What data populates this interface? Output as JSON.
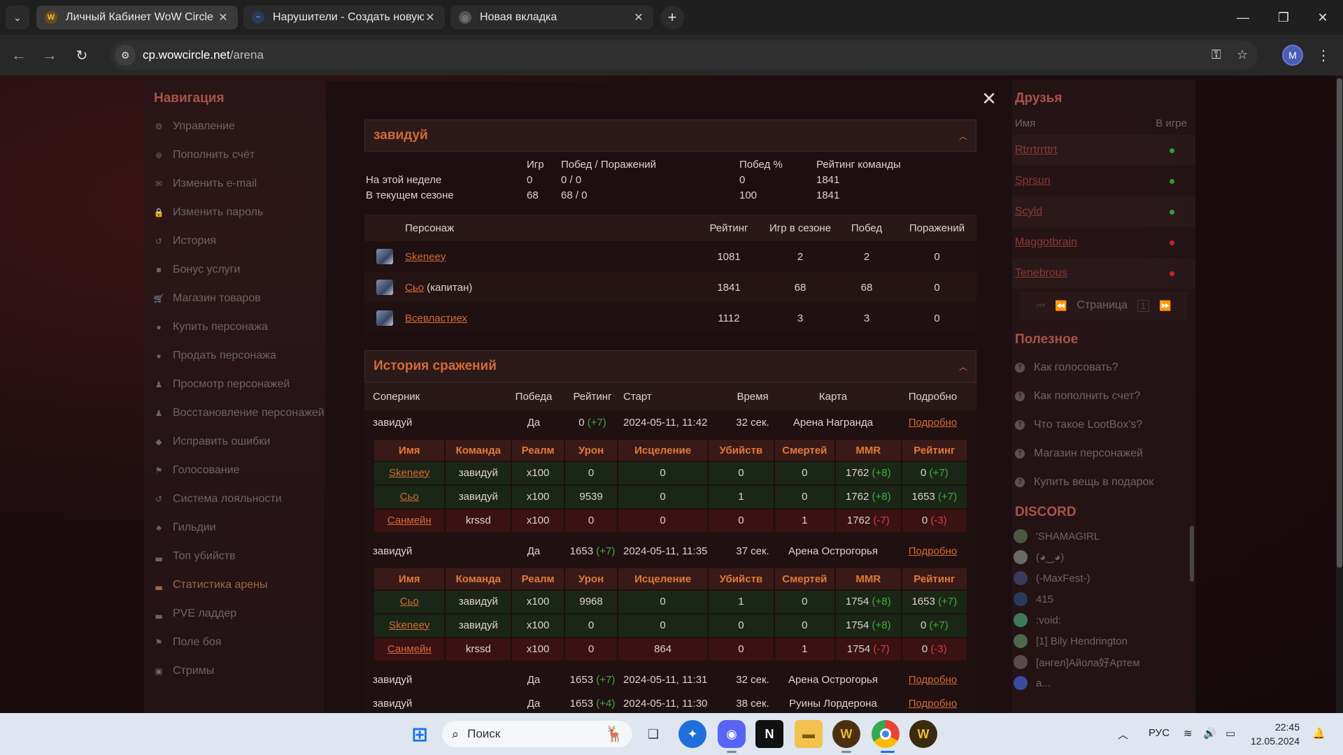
{
  "browser": {
    "tabs": [
      {
        "title": "Личный Кабинет WoW Circle I",
        "active": true
      },
      {
        "title": "Нарушители - Создать новую",
        "active": false
      },
      {
        "title": "Новая вкладка",
        "active": false
      }
    ],
    "url_host": "cp.wowcircle.net",
    "url_path": "/arena",
    "profile_initial": "M"
  },
  "leftnav": {
    "title": "Навигация",
    "items": [
      {
        "label": "Управление",
        "icon": "gear-icon",
        "glyph": "⚙"
      },
      {
        "label": "Пополнить счёт",
        "icon": "plus-circle-icon",
        "glyph": "⊕"
      },
      {
        "label": "Изменить e-mail",
        "icon": "envelope-icon",
        "glyph": "✉"
      },
      {
        "label": "Изменить пароль",
        "icon": "lock-icon",
        "glyph": "🔒"
      },
      {
        "label": "История",
        "icon": "history-icon",
        "glyph": "↺"
      },
      {
        "label": "Бонус услуги",
        "icon": "bonus-icon",
        "glyph": "■"
      },
      {
        "label": "Магазин товаров",
        "icon": "cart-icon",
        "glyph": "🛒"
      },
      {
        "label": "Купить персонажа",
        "icon": "user-icon",
        "glyph": "●"
      },
      {
        "label": "Продать персонажа",
        "icon": "user-icon",
        "glyph": "●"
      },
      {
        "label": "Просмотр персонажей",
        "icon": "male-icon",
        "glyph": "♟"
      },
      {
        "label": "Восстановление персонажей",
        "icon": "male-icon",
        "glyph": "♟"
      },
      {
        "label": "Исправить ошибки",
        "icon": "shield-icon",
        "glyph": "◆"
      },
      {
        "label": "Голосование",
        "icon": "flag-icon",
        "glyph": "⚑"
      },
      {
        "label": "Система лояльности",
        "icon": "history-icon",
        "glyph": "↺"
      },
      {
        "label": "Гильдии",
        "icon": "users-icon",
        "glyph": "♣"
      },
      {
        "label": "Топ убийств",
        "icon": "chart-icon",
        "glyph": "▃"
      },
      {
        "label": "Статистика арены",
        "icon": "chart-icon",
        "glyph": "▃",
        "active": true
      },
      {
        "label": "PVE ладдер",
        "icon": "chart-icon",
        "glyph": "▃"
      },
      {
        "label": "Поле боя",
        "icon": "flag-icon",
        "glyph": "⚑"
      },
      {
        "label": "Стримы",
        "icon": "stream-icon",
        "glyph": "▣"
      }
    ]
  },
  "team": {
    "name": "завидуй",
    "stats_headers": {
      "games": "Игр",
      "wl": "Побед / Поражений",
      "winpct": "Побед %",
      "rating": "Рейтинг команды"
    },
    "stats_rows": [
      {
        "label": "На этой неделе",
        "games": "0",
        "wl": "0 / 0",
        "winpct": "0",
        "rating": "1841"
      },
      {
        "label": "В текущем сезоне",
        "games": "68",
        "wl": "68 / 0",
        "winpct": "100",
        "rating": "1841"
      }
    ],
    "roster_headers": [
      "Персонаж",
      "Рейтинг",
      "Игр в сезоне",
      "Побед",
      "Поражений"
    ],
    "roster": [
      {
        "name": "Skeneey",
        "suffix": "",
        "rating": "1081",
        "games": "2",
        "wins": "2",
        "losses": "0"
      },
      {
        "name": "Сьо",
        "suffix": " (капитан)",
        "rating": "1841",
        "games": "68",
        "wins": "68",
        "losses": "0"
      },
      {
        "name": "Всевластиех",
        "suffix": "",
        "rating": "1112",
        "games": "3",
        "wins": "3",
        "losses": "0"
      }
    ]
  },
  "history": {
    "title": "История сражений",
    "headers": [
      "Соперник",
      "Победа",
      "Рейтинг",
      "Старт",
      "Время",
      "Карта",
      "Подробно"
    ],
    "detail_headers": [
      "Имя",
      "Команда",
      "Реалм",
      "Урон",
      "Исцеление",
      "Убийств",
      "Смертей",
      "MMR",
      "Рейтинг"
    ],
    "matches": [
      {
        "opponent": "завидуй",
        "win": "Да",
        "rating": "0",
        "rating_delta": "(+7)",
        "start": "2024-05-11, 11:42",
        "time": "32 сек.",
        "map": "Арена Награнда",
        "details": "Подробно",
        "players": [
          {
            "name": "Skeneey",
            "team": "завидуй",
            "realm": "x100",
            "damage": "0",
            "heal": "0",
            "kills": "0",
            "deaths": "0",
            "mmr": "1762",
            "mmr_delta": "(+8)",
            "rating": "0",
            "rating_delta": "(+7)",
            "side": "ally"
          },
          {
            "name": "Сьо",
            "team": "завидуй",
            "realm": "x100",
            "damage": "9539",
            "heal": "0",
            "kills": "1",
            "deaths": "0",
            "mmr": "1762",
            "mmr_delta": "(+8)",
            "rating": "1653",
            "rating_delta": "(+7)",
            "side": "ally"
          },
          {
            "name": "Санмейн",
            "team": "krssd",
            "realm": "x100",
            "damage": "0",
            "heal": "0",
            "kills": "0",
            "deaths": "1",
            "mmr": "1762",
            "mmr_delta": "(-7)",
            "rating": "0",
            "rating_delta": "(-3)",
            "side": "enemy"
          }
        ]
      },
      {
        "opponent": "завидуй",
        "win": "Да",
        "rating": "1653",
        "rating_delta": "(+7)",
        "start": "2024-05-11, 11:35",
        "time": "37 сек.",
        "map": "Арена Острогорья",
        "details": "Подробно",
        "players": [
          {
            "name": "Сьо",
            "team": "завидуй",
            "realm": "x100",
            "damage": "9968",
            "heal": "0",
            "kills": "1",
            "deaths": "0",
            "mmr": "1754",
            "mmr_delta": "(+8)",
            "rating": "1653",
            "rating_delta": "(+7)",
            "side": "ally"
          },
          {
            "name": "Skeneey",
            "team": "завидуй",
            "realm": "x100",
            "damage": "0",
            "heal": "0",
            "kills": "0",
            "deaths": "0",
            "mmr": "1754",
            "mmr_delta": "(+8)",
            "rating": "0",
            "rating_delta": "(+7)",
            "side": "ally"
          },
          {
            "name": "Санмейн",
            "team": "krssd",
            "realm": "x100",
            "damage": "0",
            "heal": "864",
            "kills": "0",
            "deaths": "1",
            "mmr": "1754",
            "mmr_delta": "(-7)",
            "rating": "0",
            "rating_delta": "(-3)",
            "side": "enemy"
          }
        ]
      },
      {
        "opponent": "завидуй",
        "win": "Да",
        "rating": "1653",
        "rating_delta": "(+7)",
        "start": "2024-05-11, 11:31",
        "time": "32 сек.",
        "map": "Арена Острогорья",
        "details": "Подробно",
        "players": []
      },
      {
        "opponent": "завидуй",
        "win": "Да",
        "rating": "1653",
        "rating_delta": "(+4)",
        "start": "2024-05-11, 11:30",
        "time": "38 сек.",
        "map": "Руины Лордерона",
        "details": "Подробно",
        "players": []
      }
    ]
  },
  "friends": {
    "title": "Друзья",
    "col_name": "Имя",
    "col_ingame": "В игре",
    "list": [
      {
        "name": "Rtrrtrrttrt",
        "online": true
      },
      {
        "name": "Sprsun",
        "online": true
      },
      {
        "name": "Scyld",
        "online": true
      },
      {
        "name": "Maggotbrain",
        "online": false
      },
      {
        "name": "Tenebrous",
        "online": false
      }
    ],
    "page_label": "Страница",
    "page": "1",
    "colors": {
      "online": "#2fa12f",
      "offline": "#c02828"
    }
  },
  "useful": {
    "title": "Полезное",
    "items": [
      "Как голосовать?",
      "Как пополнить счет?",
      "Что такое LootBox's?",
      "Магазин персонажей",
      "Купить вещь в подарок"
    ]
  },
  "discord": {
    "title": "DISCORD",
    "members": [
      "'SHAMAGIRL",
      "(◕‿◕)",
      "(-MaxFest-)",
      "415",
      ":void:",
      "[1] Bily Hendrington",
      "[ангел]Айола好Артем",
      "a..."
    ]
  },
  "taskbar": {
    "search_placeholder": "Поиск",
    "language": "РУС",
    "time": "22:45",
    "date": "12.05.2024"
  }
}
